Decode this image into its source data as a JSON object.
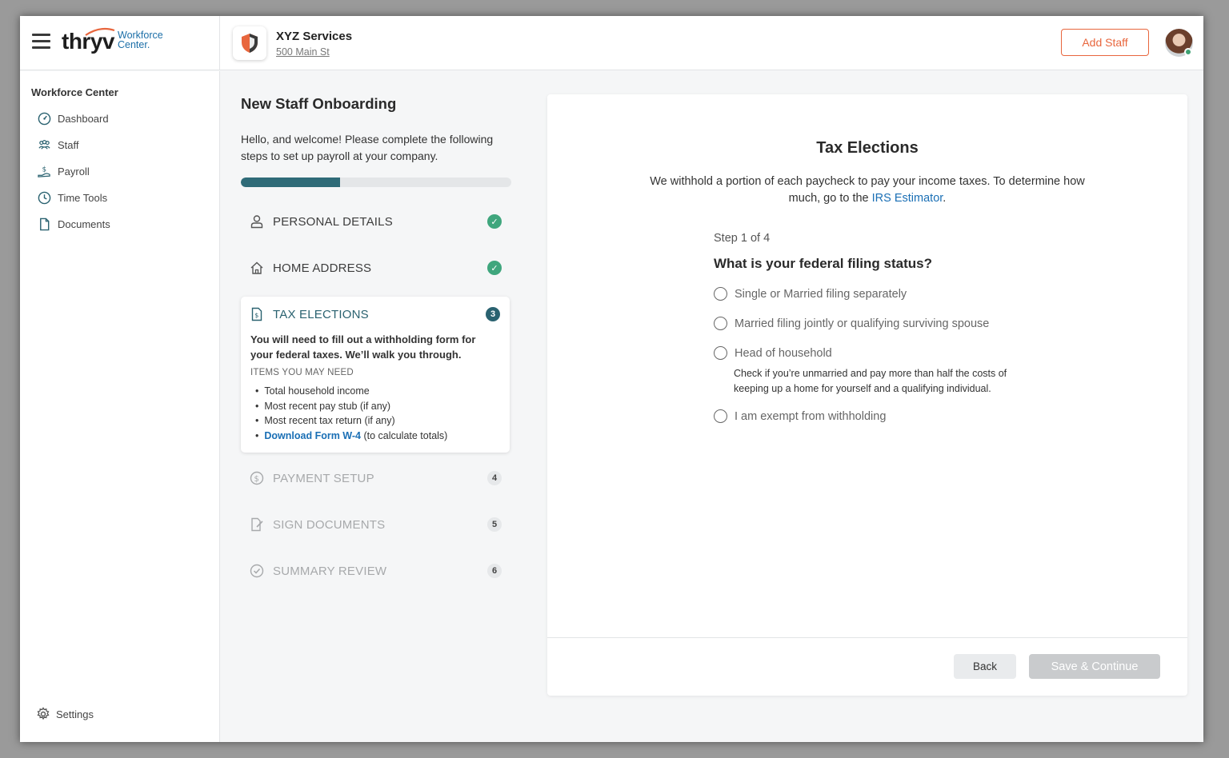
{
  "header": {
    "menu_icon": "hamburger-menu-icon",
    "logo_word": "thryv",
    "logo_sub_line1": "Workforce",
    "logo_sub_line2": "Center.",
    "business_name": "XYZ Services",
    "business_address": "500 Main St",
    "add_staff_label": "Add Staff",
    "colors": {
      "accent": "#e8663d",
      "brand_blue": "#1c6fa8",
      "online": "#3fa173"
    }
  },
  "sidebar": {
    "title": "Workforce Center",
    "items": [
      {
        "label": "Dashboard",
        "icon": "dashboard-gauge-icon"
      },
      {
        "label": "Staff",
        "icon": "staff-people-icon"
      },
      {
        "label": "Payroll",
        "icon": "payroll-hand-coin-icon"
      },
      {
        "label": "Time Tools",
        "icon": "clock-icon"
      },
      {
        "label": "Documents",
        "icon": "document-icon"
      }
    ],
    "settings_label": "Settings"
  },
  "onboarding": {
    "title": "New Staff Onboarding",
    "intro": "Hello, and welcome! Please complete the following steps to set up payroll at your company.",
    "progress_fraction": 0.367,
    "progress_color": "#2f6b78",
    "steps": [
      {
        "label": "PERSONAL DETAILS",
        "status": "complete",
        "badge": "✓",
        "icon": "person-icon"
      },
      {
        "label": "HOME ADDRESS",
        "status": "complete",
        "badge": "✓",
        "icon": "home-icon"
      },
      {
        "label": "TAX ELECTIONS",
        "status": "active",
        "badge": "3",
        "icon": "tax-document-icon"
      },
      {
        "label": "PAYMENT SETUP",
        "status": "upcoming",
        "badge": "4",
        "icon": "dollar-circle-icon"
      },
      {
        "label": "SIGN DOCUMENTS",
        "status": "upcoming",
        "badge": "5",
        "icon": "sign-document-icon"
      },
      {
        "label": "SUMMARY REVIEW",
        "status": "upcoming",
        "badge": "6",
        "icon": "check-circle-icon"
      }
    ],
    "active_card": {
      "description": "You will need to fill out a withholding form for your federal taxes. We’ll walk you through.",
      "items_title": "ITEMS YOU MAY NEED",
      "items": [
        "Total household income",
        "Most recent pay stub (if any)",
        "Most recent tax return (if any)"
      ],
      "download_link": "Download Form W-4",
      "download_suffix": " (to calculate totals)"
    }
  },
  "tax": {
    "title": "Tax Elections",
    "desc_before": "We withhold a portion of each paycheck to pay your income taxes. To determine how much, go to the ",
    "desc_link": "IRS Estimator",
    "desc_after": ".",
    "step_label": "Step 1 of 4",
    "question": "What is your federal filing status?",
    "options": [
      "Single or Married filing separately",
      "Married filing jointly or qualifying surviving spouse",
      "Head of household",
      "I am exempt from withholding"
    ],
    "hoh_help": "Check if you’re unmarried and pay more than half the costs of keeping up a home for yourself and a qualifying individual.",
    "back_label": "Back",
    "save_label": "Save & Continue"
  }
}
